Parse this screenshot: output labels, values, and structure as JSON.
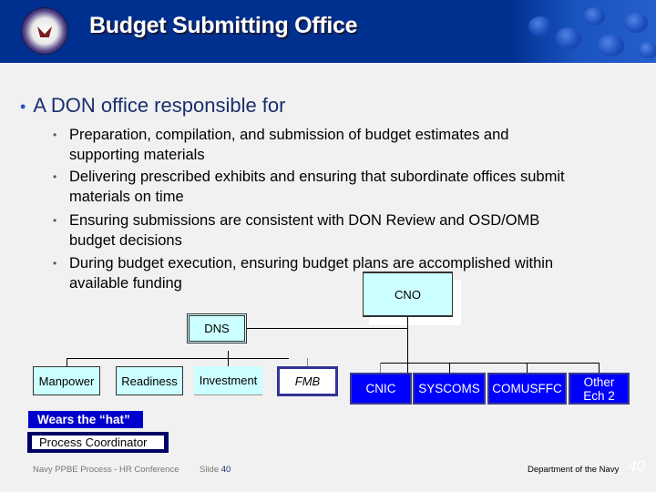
{
  "header": {
    "title": "Budget Submitting Office",
    "logo": "navy-seal-icon",
    "background_color": "#00308f"
  },
  "content": {
    "main_bullet": "A DON office responsible for",
    "sub_bullets": [
      {
        "line1": "Preparation, compilation, and submission of budget estimates and",
        "line2": "supporting materials"
      },
      {
        "line1": "Delivering prescribed exhibits and ensuring that subordinate offices submit",
        "line2": "materials on time"
      },
      {
        "line1": "Ensuring submissions are consistent with DON Review and OSD/OMB",
        "line2": "budget decisions"
      },
      {
        "line1": "During budget execution, ensuring budget plans are accomplished within",
        "line2": "available funding"
      }
    ]
  },
  "org_chart": {
    "top": "CNO",
    "staff": "DNS",
    "left_branch": [
      "Manpower",
      "Readiness",
      "Investment",
      "FMB"
    ],
    "right_branch": [
      {
        "line1": "CNIC"
      },
      {
        "line1": "SYSCOMS"
      },
      {
        "line1": "COMUSFFC"
      },
      {
        "line1": "Other",
        "line2": "Ech 2"
      }
    ],
    "colors": {
      "staff_fill": "#ccffff",
      "echelon2_fill": "#0000ff",
      "highlight_border": "#333399"
    }
  },
  "callouts": {
    "hat_label": "Wears the “hat”",
    "role": "Process Coordinator"
  },
  "footer": {
    "left": "Navy PPBE Process -  HR Conference",
    "slide_label": "Slide",
    "slide_number": "40",
    "right": "Department of the Navy",
    "page_number": "40"
  }
}
